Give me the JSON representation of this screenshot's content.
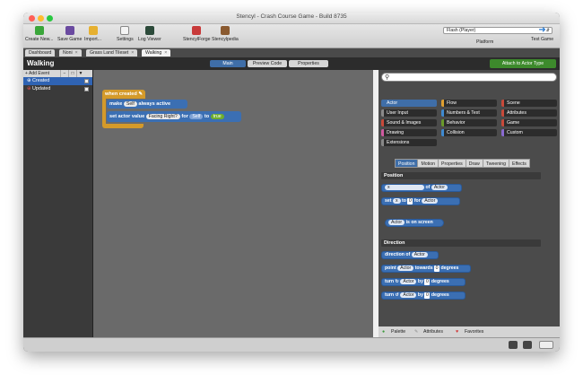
{
  "window": {
    "title": "Stencyl - Crash Course Game - Build 8735"
  },
  "toolbar": {
    "items": [
      {
        "label": "Create New...",
        "icon": "create-new-icon"
      },
      {
        "label": "Save Game",
        "icon": "save-icon"
      },
      {
        "label": "Import...",
        "icon": "import-icon"
      },
      {
        "label": "Settings",
        "icon": "settings-icon"
      },
      {
        "label": "Log Viewer",
        "icon": "log-viewer-icon"
      },
      {
        "label": "StencylForge",
        "icon": "stencylforge-icon"
      },
      {
        "label": "Stencylpedia",
        "icon": "stencylpedia-icon"
      }
    ],
    "platform_select": "Flash (Player)",
    "platform_label": "Platform",
    "test_label": "Test Game"
  },
  "tabs": [
    {
      "label": "Dashboard"
    },
    {
      "label": "Noni",
      "closable": true
    },
    {
      "label": "Grass Land Tileset",
      "closable": true
    },
    {
      "label": "Walking",
      "closable": true,
      "active": true
    }
  ],
  "header": {
    "title": "Walking",
    "segments": [
      "Main",
      "Preview Code",
      "Properties"
    ],
    "active_segment": "Main",
    "attach_label": "Attach to Actor Type"
  },
  "events": {
    "add_label": "+ Add Event",
    "items": [
      {
        "label": "Created",
        "selected": true
      },
      {
        "label": "Updated",
        "selected": false
      }
    ]
  },
  "canvas": {
    "when_label": "when created",
    "row1": {
      "make": "make",
      "self": "Self",
      "always_active": "always active"
    },
    "row2": {
      "set_label": "set actor value",
      "value_name": "Facing Right?",
      "for": "for",
      "self": "Self",
      "to": "to",
      "value": "true"
    }
  },
  "palette": {
    "categories": [
      {
        "label": "Actor",
        "color": "#3f6ea8",
        "selected": true
      },
      {
        "label": "Flow",
        "color": "#e0a030"
      },
      {
        "label": "Scene",
        "color": "#c84a3a"
      },
      {
        "label": "User Input",
        "color": "#8a8a8a"
      },
      {
        "label": "Numbers & Text",
        "color": "#3f8ad0"
      },
      {
        "label": "Attributes",
        "color": "#c84a3a"
      },
      {
        "label": "Sound & Images",
        "color": "#c84a3a"
      },
      {
        "label": "Behavior",
        "color": "#6a9a2a"
      },
      {
        "label": "Game",
        "color": "#c84a3a"
      },
      {
        "label": "Drawing",
        "color": "#d05aa0"
      },
      {
        "label": "Collision",
        "color": "#3f8ad0"
      },
      {
        "label": "Custom",
        "color": "#8a6ad0"
      },
      {
        "label": "Extensions",
        "color": "#888888"
      }
    ],
    "subtabs": [
      "Position",
      "Motion",
      "Properties",
      "Draw",
      "Tweening",
      "Effects"
    ],
    "active_subtab": "Position",
    "sections": [
      {
        "title": "Position"
      },
      {
        "title": "Direction"
      }
    ],
    "position_blocks": {
      "b1": {
        "field": "x",
        "of": "of",
        "actor": "Actor"
      },
      "b2": {
        "set": "set",
        "field": "x",
        "to": "to",
        "num": "0",
        "for": "for",
        "actor": "Actor"
      },
      "b3": {
        "actor": "Actor",
        "text": "is on screen"
      }
    },
    "direction_blocks": {
      "d1": {
        "label": "direction of",
        "actor": "Actor"
      },
      "d2": {
        "point": "point",
        "actor": "Actor",
        "towards": "towards",
        "num": "0",
        "degrees": "degrees"
      },
      "d3": {
        "turn": "turn",
        "actor": "Actor",
        "by": "by",
        "num": "0",
        "degrees": "degrees"
      },
      "d4": {
        "turn": "turn",
        "actor": "Actor",
        "by": "by",
        "num": "0",
        "degrees": "degrees"
      }
    },
    "bottom_tabs": [
      "Palette",
      "Attributes",
      "Favorites"
    ]
  }
}
